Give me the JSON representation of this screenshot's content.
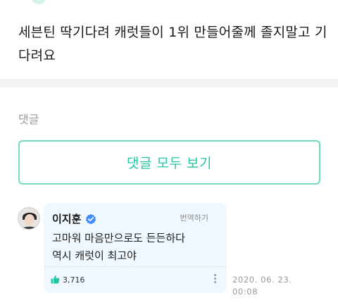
{
  "post": {
    "text": "세븐틴 딱기다려 캐럿들이 1위 만들어줄께 졸지말고 기다려요"
  },
  "comments": {
    "header_label": "댓글",
    "view_all_label": "댓글 모두 보기",
    "items": [
      {
        "author": "이지훈",
        "verified": true,
        "translate_label": "번역하기",
        "lines": [
          "고마워 마음만으로도 든든하다",
          "역시 캐럿이 최고야"
        ],
        "likes": "3,716",
        "timestamp": "2020. 06. 23. 00:08"
      }
    ]
  },
  "colors": {
    "accent": "#27c4a5",
    "accent_border": "#6fd9c3",
    "bubble_bg": "#f0f8ff",
    "verified_blue": "#3d8bfd",
    "section_gap": "#f2f3f5"
  },
  "icons": {
    "verified": "verified-badge-icon",
    "like": "thumbs-up-icon",
    "more": "more-vertical-icon"
  }
}
